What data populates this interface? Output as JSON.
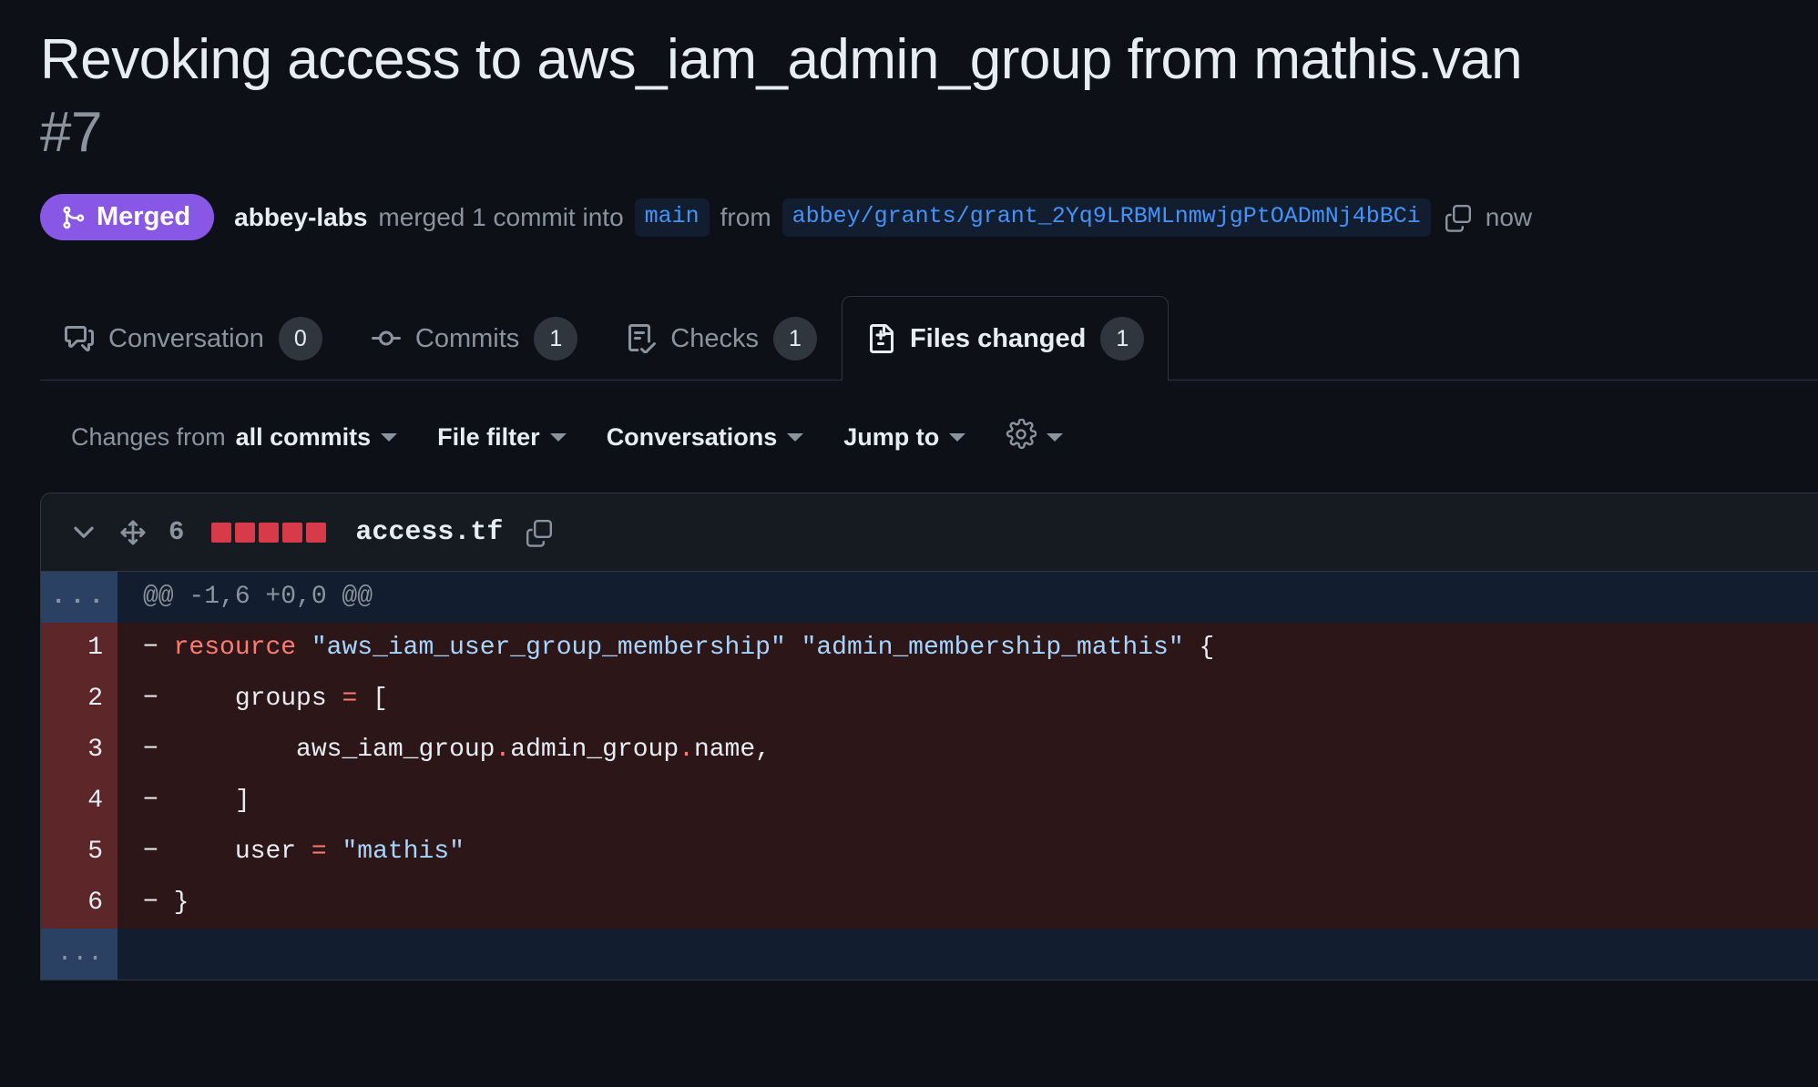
{
  "pull_request": {
    "title": "Revoking access to aws_iam_admin_group from mathis.van",
    "number": "#7",
    "state_label": "Merged",
    "state_color": "#8957e5",
    "merge_summary": {
      "author": "abbey-labs",
      "verb_1": "merged 1 commit into",
      "base_branch": "main",
      "verb_2": "from",
      "head_branch": "abbey/grants/grant_2Yq9LRBMLnmwjgPtOADmNj4bBCi",
      "copy_icon": "copy-icon",
      "relative_time": "now"
    }
  },
  "tabs": [
    {
      "label": "Conversation",
      "count": "0",
      "icon": "comment-discussion-icon",
      "selected": false
    },
    {
      "label": "Commits",
      "count": "1",
      "icon": "git-commit-icon",
      "selected": false
    },
    {
      "label": "Checks",
      "count": "1",
      "icon": "checklist-icon",
      "selected": false
    },
    {
      "label": "Files changed",
      "count": "1",
      "icon": "file-diff-icon",
      "selected": true
    }
  ],
  "subtoolbar": {
    "changes_from_prefix": "Changes from",
    "changes_from_value": "all commits",
    "file_filter": "File filter",
    "conversations": "Conversations",
    "jump_to": "Jump to",
    "settings_icon": "gear-icon"
  },
  "file_diff": {
    "collapse_icon": "chevron-down-icon",
    "move_icon": "diff-move-icon",
    "change_count": "6",
    "diffstat_blocks": [
      "del",
      "del",
      "del",
      "del",
      "del"
    ],
    "filename": "access.tf",
    "copy_icon": "copy-icon",
    "expand_up_label": "...",
    "expand_down_label": "...",
    "hunk_header": "@@ -1,6 +0,0 @@",
    "lines": [
      {
        "number": "1",
        "marker": "−",
        "tokens": [
          {
            "t": "resource",
            "c": "tok-kw"
          },
          {
            "t": " ",
            "c": "tok-plain"
          },
          {
            "t": "\"aws_iam_user_group_membership\"",
            "c": "tok-str"
          },
          {
            "t": " ",
            "c": "tok-plain"
          },
          {
            "t": "\"admin_membership_mathis\"",
            "c": "tok-str"
          },
          {
            "t": " {",
            "c": "tok-plain"
          }
        ]
      },
      {
        "number": "2",
        "marker": "−",
        "tokens": [
          {
            "t": "    groups ",
            "c": "tok-plain"
          },
          {
            "t": "=",
            "c": "tok-punct"
          },
          {
            "t": " [",
            "c": "tok-plain"
          }
        ]
      },
      {
        "number": "3",
        "marker": "−",
        "tokens": [
          {
            "t": "        aws_iam_group",
            "c": "tok-plain"
          },
          {
            "t": ".",
            "c": "tok-punct"
          },
          {
            "t": "admin_group",
            "c": "tok-plain"
          },
          {
            "t": ".",
            "c": "tok-punct"
          },
          {
            "t": "name,",
            "c": "tok-plain"
          }
        ]
      },
      {
        "number": "4",
        "marker": "−",
        "tokens": [
          {
            "t": "    ]",
            "c": "tok-plain"
          }
        ]
      },
      {
        "number": "5",
        "marker": "−",
        "tokens": [
          {
            "t": "    user ",
            "c": "tok-plain"
          },
          {
            "t": "=",
            "c": "tok-punct"
          },
          {
            "t": " ",
            "c": "tok-plain"
          },
          {
            "t": "\"mathis\"",
            "c": "tok-str"
          }
        ]
      },
      {
        "number": "6",
        "marker": "−",
        "tokens": [
          {
            "t": "}",
            "c": "tok-plain"
          }
        ]
      }
    ]
  }
}
